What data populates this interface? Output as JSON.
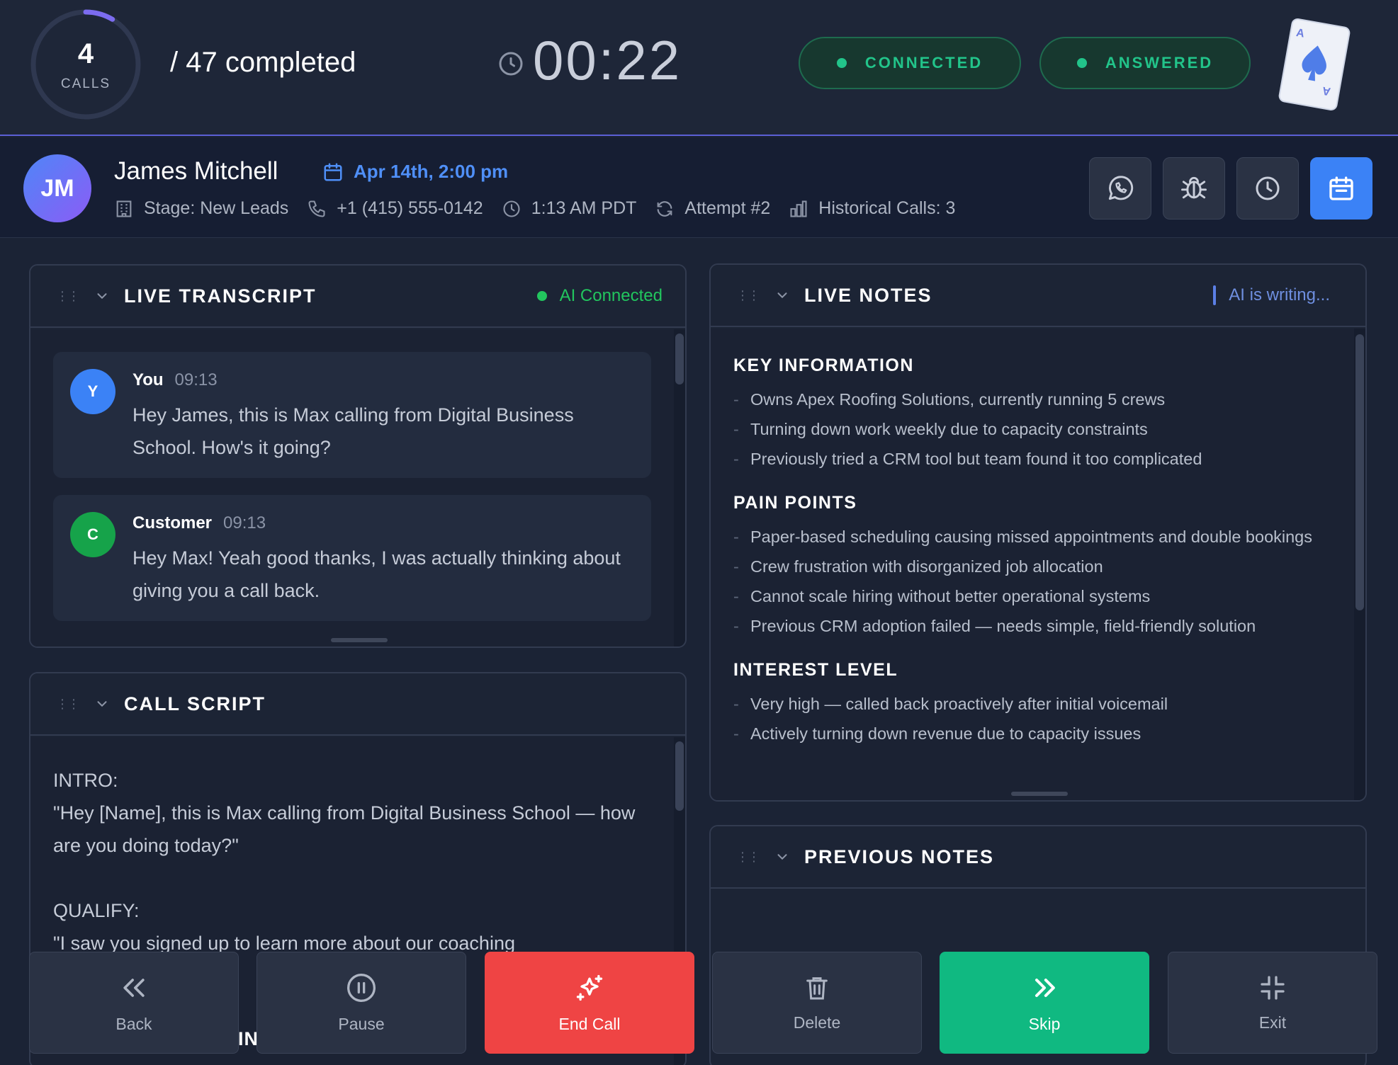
{
  "header": {
    "calls_count": "4",
    "calls_label": "CALLS",
    "progress_fraction": 0.085,
    "completed_text": "/ 47 completed",
    "timer": "00:22",
    "status_connected": "CONNECTED",
    "status_answered": "ANSWERED"
  },
  "contact": {
    "initials": "JM",
    "name": "James Mitchell",
    "appointment": "Apr 14th, 2:00 pm",
    "stage": "Stage: New Leads",
    "phone": "+1 (415) 555-0142",
    "local_time": "1:13 AM PDT",
    "attempt": "Attempt #2",
    "historical_calls": "Historical Calls: 3"
  },
  "transcript": {
    "title": "LIVE TRANSCRIPT",
    "status": "AI Connected",
    "messages": [
      {
        "initial": "Y",
        "speaker": "You",
        "time": "09:13",
        "text": "Hey James, this is Max calling from Digital Business School. How's it going?"
      },
      {
        "initial": "C",
        "speaker": "Customer",
        "time": "09:13",
        "text": "Hey Max! Yeah good thanks, I was actually thinking about giving you a call back."
      }
    ]
  },
  "script": {
    "title": "CALL SCRIPT",
    "text": "INTRO:\n\"Hey [Name], this is Max calling from Digital Business School — how are you doing today?\"\n\nQUALIFY:\n\"I saw you signed up to learn more about our coaching",
    "peek_text": "IN"
  },
  "notes": {
    "title": "LIVE NOTES",
    "status": "AI is writing...",
    "sections": [
      {
        "title": "KEY INFORMATION",
        "items": [
          "Owns Apex Roofing Solutions, currently running 5 crews",
          "Turning down work weekly due to capacity constraints",
          "Previously tried a CRM tool but team found it too complicated"
        ]
      },
      {
        "title": "PAIN POINTS",
        "items": [
          "Paper-based scheduling causing missed appointments and double bookings",
          "Crew frustration with disorganized job allocation",
          "Cannot scale hiring without better operational systems",
          "Previous CRM adoption failed — needs simple, field-friendly solution"
        ]
      },
      {
        "title": "INTEREST LEVEL",
        "items": [
          "Very high — called back proactively after initial voicemail",
          "Actively turning down revenue due to capacity issues"
        ]
      }
    ]
  },
  "previous_notes": {
    "title": "PREVIOUS NOTES"
  },
  "actions": {
    "back": "Back",
    "pause": "Pause",
    "end_call": "End Call",
    "delete": "Delete",
    "skip": "Skip",
    "exit": "Exit"
  },
  "colors": {
    "accent_blue": "#3b82f6",
    "success_green": "#22c48a",
    "danger_red": "#ef4444",
    "skip_green": "#10b981"
  }
}
